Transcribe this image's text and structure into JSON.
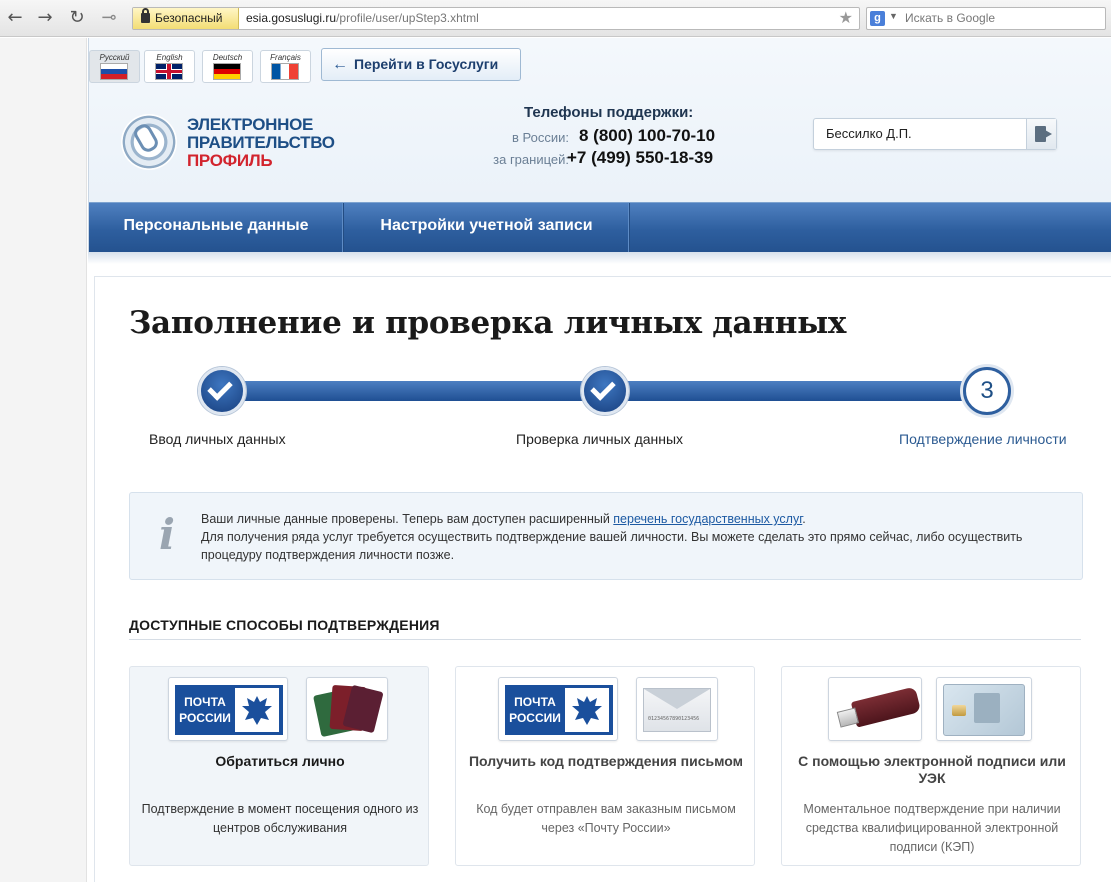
{
  "browser": {
    "back_glyph": "←",
    "forward_glyph": "→",
    "reload_glyph": "↻",
    "key_glyph": "⊸",
    "secure_label": "Безопасный",
    "url_host": "esia.gosuslugi.ru",
    "url_path": "/profile/user/upStep3.xhtml",
    "star_glyph": "★",
    "search_engine_letter": "g",
    "search_placeholder": "Искать в Google"
  },
  "header": {
    "languages": [
      {
        "label": "Русский",
        "flag": "ru",
        "active": true
      },
      {
        "label": "English",
        "flag": "en"
      },
      {
        "label": "Deutsch",
        "flag": "de"
      },
      {
        "label": "Français",
        "flag": "fr"
      }
    ],
    "goto_button": "Перейти в Госуслуги",
    "goto_arrow": "←",
    "logo": {
      "line1": "ЭЛЕКТРОННОЕ",
      "line2": "ПРАВИТЕЛЬСТВО",
      "line3": "ПРОФИЛЬ"
    },
    "support": {
      "title": "Телефоны поддержки:",
      "russia_label": "в России:",
      "russia_phone": "8 (800) 100-70-10",
      "abroad_label": "за границей:",
      "abroad_phone": "+7 (499) 550-18-39"
    },
    "user_name": "Бессилко Д.П.",
    "nav": [
      {
        "label": "Персональные данные"
      },
      {
        "label": "Настройки учетной записи"
      }
    ]
  },
  "main": {
    "title": "Заполнение и проверка личных данных",
    "steps": [
      {
        "label": "Ввод личных данных",
        "state": "done"
      },
      {
        "label": "Проверка личных данных",
        "state": "done"
      },
      {
        "label": "Подтверждение личности",
        "state": "current",
        "number": "3"
      }
    ],
    "info": {
      "icon_glyph": "i",
      "line1_before": "Ваши личные данные проверены. Теперь вам доступен расширенный ",
      "line1_link": "перечень государственных услуг",
      "line1_after": ".",
      "line2": "Для получения ряда услуг требуется осуществить подтверждение вашей личности. Вы можете сделать это прямо сейчас, либо осуществить процедуру подтверждения личности позже."
    },
    "section_title": "ДОСТУПНЫЕ СПОСОБЫ ПОДТВЕРЖДЕНИЯ",
    "methods": [
      {
        "title": "Обратиться лично",
        "description": "Подтверждение в момент посещения одного из центров обслуживания"
      },
      {
        "title": "Получить код подтверждения письмом",
        "description": "Код будет отправлен вам заказным письмом через «Почту России»"
      },
      {
        "title": "С помощью электронной подписи или УЭК",
        "description": "Моментальное подтверждение при наличии средства квалифицированной электронной подписи (КЭП)"
      }
    ],
    "post_logo_text": "ПОЧТА РОССИИ",
    "envelope_code": "01234567890123456"
  },
  "colors": {
    "brand_blue": "#2e5f9f",
    "logo_red": "#d2242e",
    "link_blue": "#1d5aa3"
  }
}
